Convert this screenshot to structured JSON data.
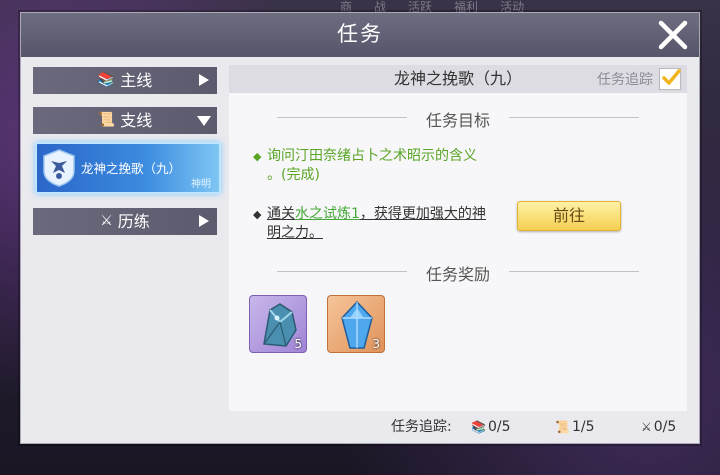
{
  "top_tabs": [
    "商",
    "战",
    "活跃",
    "福利",
    "活动"
  ],
  "dialog": {
    "title": "任务",
    "close_icon": "close-x-icon"
  },
  "sidebar": {
    "categories": [
      {
        "label": "主线",
        "icon": "book-icon",
        "expanded": false
      },
      {
        "label": "支线",
        "icon": "scroll-icon",
        "expanded": true
      },
      {
        "label": "历练",
        "icon": "sword-icon",
        "expanded": false
      }
    ],
    "quest_card": {
      "name": "龙神之挽歌（九）",
      "tag": "神明",
      "icon": "dragon-emblem-icon"
    }
  },
  "quest": {
    "title": "龙神之挽歌（九）",
    "track_label": "任务追踪",
    "track_checked": true,
    "objectives_heading": "任务目标",
    "objective1": "询问汀田奈绪占卜之术昭示的含义。(完成)",
    "objective1_line1": "询问汀田奈绪占卜之术昭示的含义",
    "objective1_line2": "。(完成)",
    "objective2_prefix": "通关",
    "objective2_link": "水之试炼1",
    "objective2_suffix_line1": "，获得更加强大的神",
    "objective2_suffix_line2": "明之力。",
    "goto_button": "前往",
    "rewards_heading": "任务奖励",
    "rewards": [
      {
        "icon": "dragon-crystal-icon",
        "count": "5"
      },
      {
        "icon": "blue-gem-icon",
        "count": "3"
      }
    ]
  },
  "stats": {
    "label": "任务追踪:",
    "main": "0/5",
    "branch": "1/5",
    "training": "0/5"
  },
  "colors": {
    "accent_gold": "#f4cf52",
    "complete_green": "#5aa526",
    "selected_blue": "#3c8ce0"
  }
}
